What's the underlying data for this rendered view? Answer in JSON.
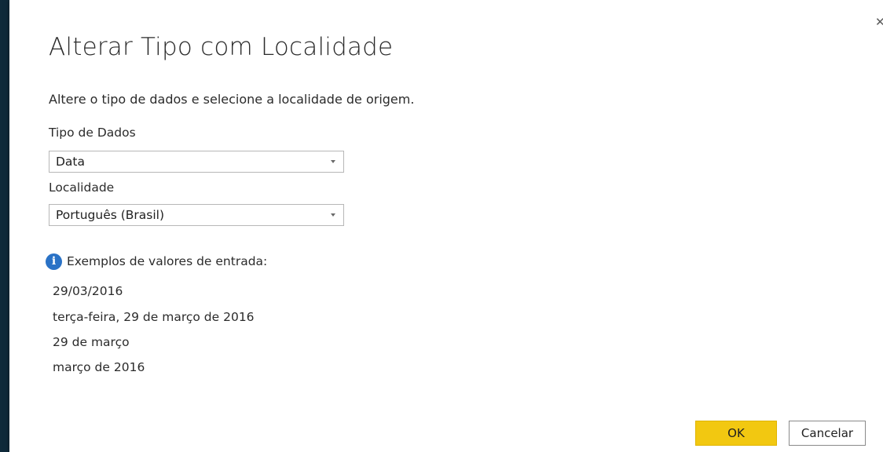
{
  "dialog": {
    "title": "Alterar Tipo com Localidade",
    "subtitle": "Altere o tipo de dados e selecione a localidade de origem.",
    "close_label": "✕"
  },
  "data_type": {
    "label": "Tipo de Dados",
    "selected": "Data"
  },
  "locale": {
    "label": "Localidade",
    "selected": "Português (Brasil)"
  },
  "examples": {
    "icon": "info-icon",
    "heading": "Exemplos de valores de entrada:",
    "items": [
      "29/03/2016",
      "terça-feira, 29 de março de 2016",
      "29 de março",
      "março de 2016"
    ]
  },
  "buttons": {
    "ok_label": "OK",
    "cancel_label": "Cancelar"
  },
  "colors": {
    "accent_ok": "#f2c811",
    "info_icon": "#2a72c6"
  }
}
